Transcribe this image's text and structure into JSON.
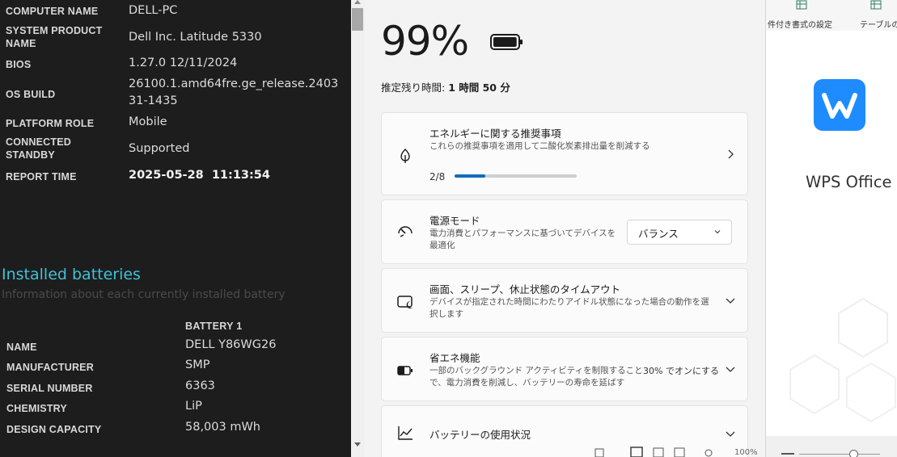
{
  "report": {
    "info": [
      {
        "label": "COMPUTER NAME",
        "value": "DELL-PC"
      },
      {
        "label": "SYSTEM PRODUCT NAME",
        "value": "Dell Inc. Latitude 5330"
      },
      {
        "label": "BIOS",
        "value": "1.27.0 12/11/2024"
      },
      {
        "label": "OS BUILD",
        "value": "26100.1.amd64fre.ge_release.240331-1435"
      },
      {
        "label": "PLATFORM ROLE",
        "value": "Mobile"
      },
      {
        "label": "CONNECTED STANDBY",
        "value": "Supported"
      },
      {
        "label": "REPORT TIME",
        "value": "2025-05-28  11:13:54"
      }
    ],
    "installed_title": "Installed batteries",
    "installed_subtitle": "Information about each currently installed battery",
    "battery_column": "BATTERY 1",
    "battery_rows": [
      {
        "label": "NAME",
        "value": "DELL Y86WG26"
      },
      {
        "label": "MANUFACTURER",
        "value": "SMP"
      },
      {
        "label": "SERIAL NUMBER",
        "value": "6363"
      },
      {
        "label": "CHEMISTRY",
        "value": "LiP"
      },
      {
        "label": "DESIGN CAPACITY",
        "value": "58,003 mWh"
      }
    ]
  },
  "flyout": {
    "percent": "99%",
    "battery_level": 0.99,
    "remaining_label": "推定残り時間: ",
    "remaining_value": "1 時間 50 分",
    "cards": {
      "energy": {
        "title": "エネルギーに関する推奨事項",
        "desc": "これらの推奨事項を適用して二酸化炭素排出量を削減する",
        "progress_label": "2/8",
        "progress_fraction": 0.25
      },
      "power_mode": {
        "title": "電源モード",
        "desc_line1": "電力消費とパフォーマンスに基づいてデバイスを",
        "desc_line2": "最適化",
        "selected": "バランス"
      },
      "sleep": {
        "title": "画面、スリープ、休止状態のタイムアウト",
        "desc_line1": "デバイスが指定された時間にわたりアイドル状態になった場合の動作を選",
        "desc_line2": "択します"
      },
      "saver": {
        "title": "省エネ機能",
        "desc_line1": "一部のバックグラウンド アクティビティを制限すること",
        "desc_line2": "で、電力消費を削減し、バッテリーの寿命を延ばす",
        "status": "30% でオンにする"
      },
      "usage": {
        "title": "バッテリーの使用状況"
      }
    }
  },
  "wps": {
    "ribbon_text1": "件付き書式の設定",
    "ribbon_text2": "テーブルの",
    "app_name": "WPS Office",
    "zoom": "100%"
  },
  "colors": {
    "report_bg": "#1d1d1d",
    "accent_cyan": "#3fc2d8",
    "progress_blue": "#0f6cbd",
    "wps_blue": "#1e8cff"
  }
}
